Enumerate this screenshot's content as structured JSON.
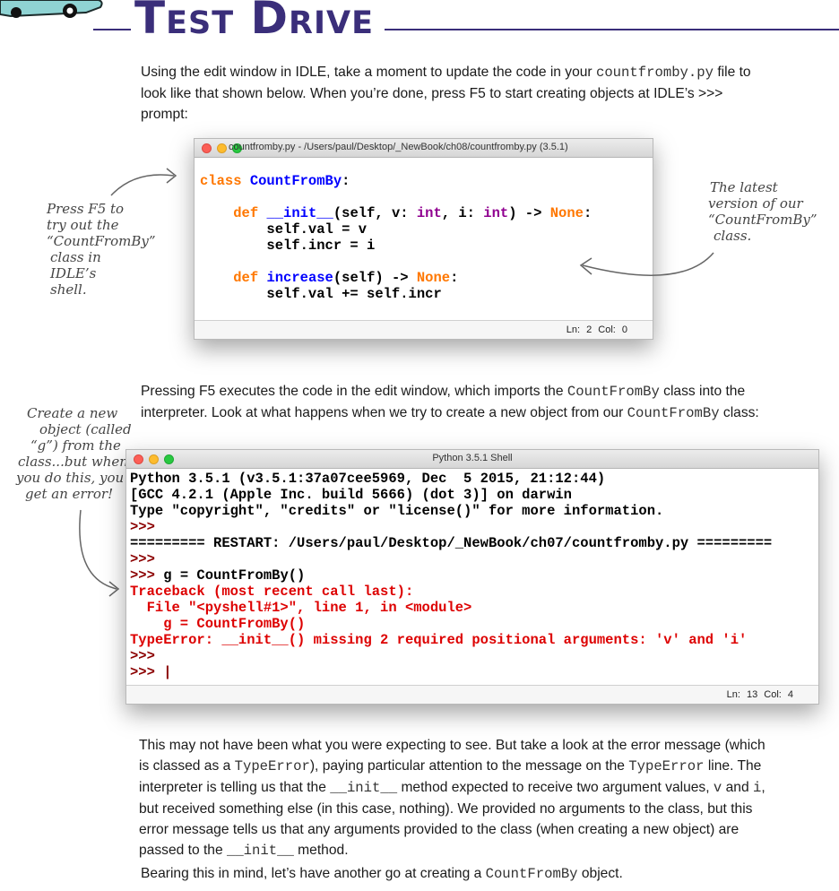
{
  "header": {
    "title": "Test Drive"
  },
  "intro": {
    "t1": "Using the edit window in IDLE, take a moment to update the code in your ",
    "code1": "countfromby.py",
    "t2": " file to look like that shown below. When you’re done, press F5 to start creating objects at IDLE’s >>> prompt:"
  },
  "editor": {
    "title": "countfromby.py - /Users/paul/Desktop/_NewBook/ch08/countfromby.py (3.5.1)",
    "status": "Ln: 2  Col: 0",
    "code": {
      "l1_kw": "class ",
      "l1_name": "CountFromBy",
      "l1_rest": ":",
      "l2_indent": "    ",
      "l2_kw": "def ",
      "l2_name": "__init__",
      "l2_a": "(self, v: ",
      "l2_int1": "int",
      "l2_b": ", i: ",
      "l2_int2": "int",
      "l2_c": ") -> ",
      "l2_none": "None",
      "l2_d": ":",
      "l3": "        self.val = v",
      "l4": "        self.incr = i",
      "l5_indent": "    ",
      "l5_kw": "def ",
      "l5_name": "increase",
      "l5_a": "(self) -> ",
      "l5_none": "None",
      "l5_b": ":",
      "l6": "        self.val += self.incr"
    }
  },
  "annotations": {
    "press_f5": [
      "Press F5 to",
      "try out the",
      "“CountFromBy”",
      "class in IDLE’s",
      "shell."
    ],
    "latest_version": [
      "The latest",
      "version of our",
      "“CountFromBy”",
      "class."
    ],
    "create_object": [
      "Create a new",
      "object (called",
      "“g”) from the",
      "class...but when",
      "you do this, you",
      "get an error!"
    ]
  },
  "middle": {
    "t1": "Pressing F5 executes the code in the edit window, which imports the ",
    "code1": "CountFromBy",
    "t2": " class into the interpreter. Look at what happens when we try to create a new object from our ",
    "code2": "CountFromBy",
    "t3": " class:"
  },
  "shell": {
    "title": "Python 3.5.1 Shell",
    "status": "Ln: 13  Col: 4",
    "lines": {
      "l1": "Python 3.5.1 (v3.5.1:37a07cee5969, Dec  5 2015, 21:12:44)",
      "l2": "[GCC 4.2.1 (Apple Inc. build 5666) (dot 3)] on darwin",
      "l3": "Type \"copyright\", \"credits\" or \"license()\" for more information.",
      "l4": ">>>",
      "l5": "========= RESTART: /Users/paul/Desktop/_NewBook/ch07/countfromby.py =========",
      "l6": ">>>",
      "l7_prompt": ">>> ",
      "l7_code": "g = CountFromBy()",
      "l8": "Traceback (most recent call last):",
      "l9": "  File \"<pyshell#1>\", line 1, in <module>",
      "l10": "    g = CountFromBy()",
      "l11": "TypeError: __init__() missing 2 required positional arguments: 'v' and 'i'",
      "l12": ">>>",
      "l13": ">>> |"
    }
  },
  "explanation": {
    "t1": "This may not have been what you were expecting to see. But take a look at the error message (which is classed as a ",
    "code1": "TypeError",
    "t2": "), paying particular attention to the message on the ",
    "code2": "TypeError",
    "t3": " line. The interpreter is telling us that the ",
    "code3": "__init__",
    "t4": " method expected to receive two argument values, ",
    "code4": "v",
    "t5": " and ",
    "code5": "i",
    "t6": ", but received something else (in this case, nothing). We provided no arguments to the class, but this error message tells us that any arguments provided to the class (when creating a new object) are passed to the ",
    "code6": "__init__",
    "t7": " method."
  },
  "closing": {
    "t1": "Bearing this in mind, let’s have another go at creating a ",
    "code1": "CountFromBy",
    "t2": " object."
  },
  "colors": {
    "title_purple": "#3a2e7a",
    "keyword_orange": "#ff7700",
    "definition_blue": "#0000ff",
    "builtin_purple": "#900090",
    "error_red": "#dd0000"
  }
}
